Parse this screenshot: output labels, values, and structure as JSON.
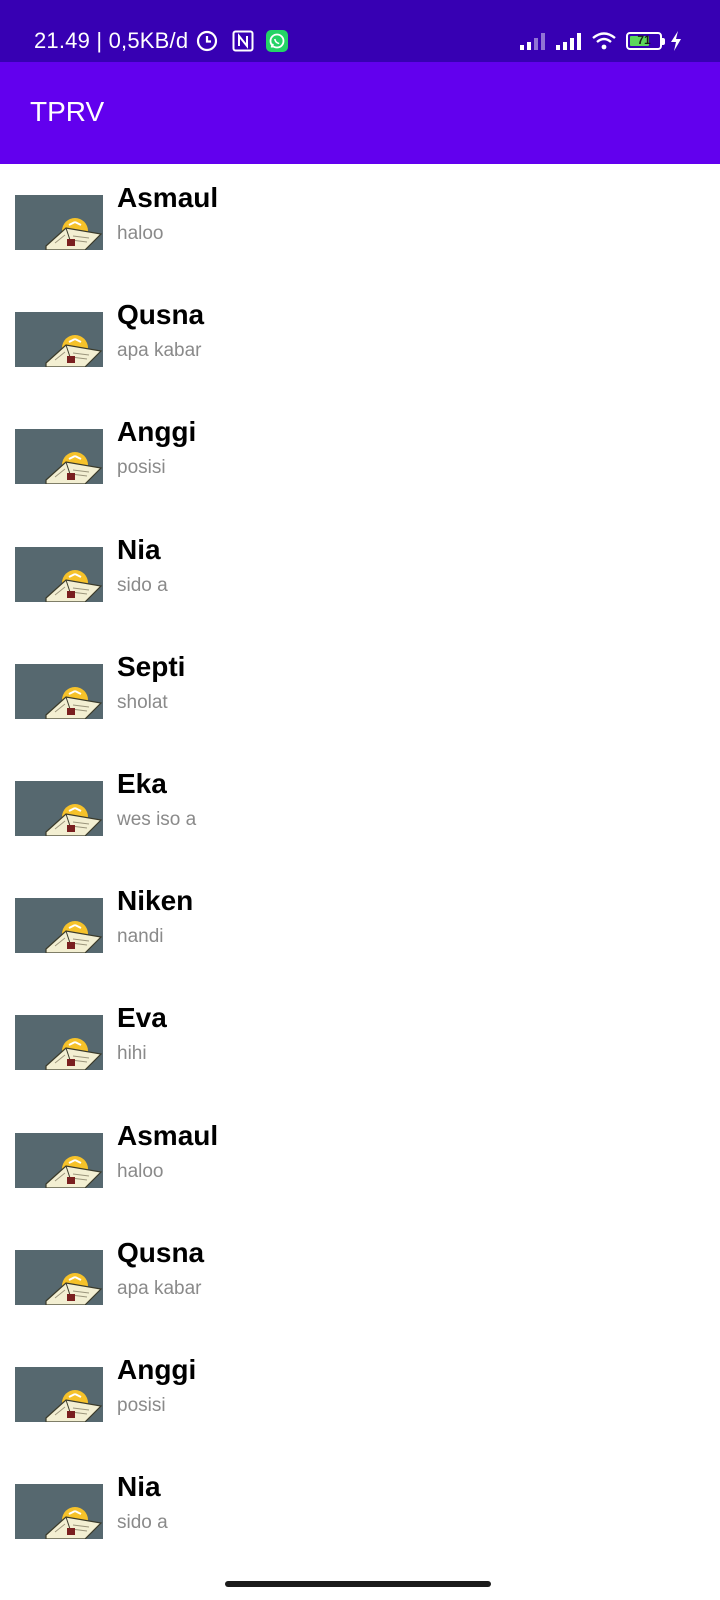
{
  "status_bar": {
    "time_and_speed": "21.49 | 0,5KB/d",
    "battery_level": "71",
    "battery_fraction": 0.71,
    "icons": [
      "alarm-clock-icon",
      "nfc-icon",
      "whatsapp-icon",
      "signal-icon",
      "signal-icon",
      "wifi-icon",
      "battery-icon",
      "charging-bolt-icon"
    ]
  },
  "app_bar": {
    "title": "TPRV"
  },
  "colors": {
    "status_bar": "#3700b3",
    "app_bar": "#6200ee",
    "thumbnail_bg": "#56686f",
    "subtitle": "#8a8a8a"
  },
  "list": {
    "thumbnail_icon": "book-with-bulb-icon",
    "items": [
      {
        "title": "Asmaul",
        "subtitle": "haloo"
      },
      {
        "title": "Qusna",
        "subtitle": "apa kabar"
      },
      {
        "title": "Anggi",
        "subtitle": "posisi"
      },
      {
        "title": "Nia",
        "subtitle": "sido a"
      },
      {
        "title": "Septi",
        "subtitle": "sholat"
      },
      {
        "title": "Eka",
        "subtitle": "wes iso a"
      },
      {
        "title": "Niken",
        "subtitle": "nandi"
      },
      {
        "title": "Eva",
        "subtitle": "hihi"
      },
      {
        "title": "Asmaul",
        "subtitle": "haloo"
      },
      {
        "title": "Qusna",
        "subtitle": "apa kabar"
      },
      {
        "title": "Anggi",
        "subtitle": "posisi"
      },
      {
        "title": "Nia",
        "subtitle": "sido a"
      }
    ]
  }
}
